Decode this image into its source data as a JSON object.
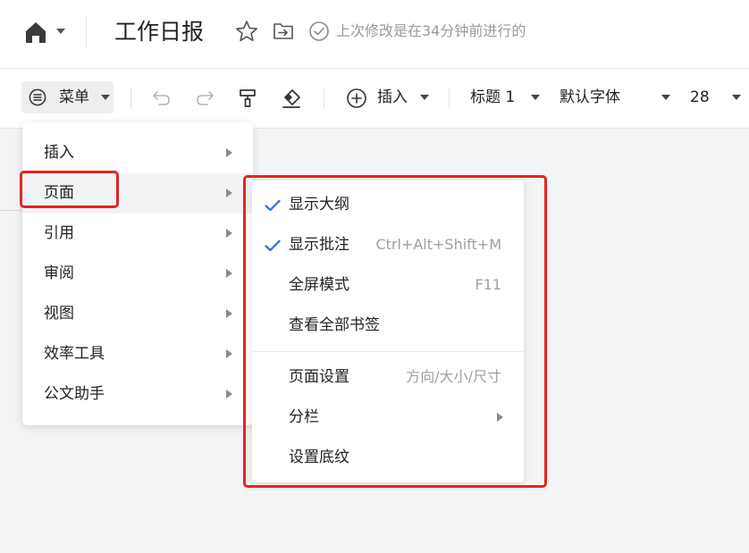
{
  "header": {
    "doc_title": "工作日报",
    "last_modified": "上次修改是在34分钟前进行的"
  },
  "toolbar": {
    "menu_label": "菜单",
    "insert_label": "插入",
    "heading_style": "标题 1",
    "font_family": "默认字体",
    "font_size": "28"
  },
  "menu": {
    "items": [
      {
        "label": "插入"
      },
      {
        "label": "页面"
      },
      {
        "label": "引用"
      },
      {
        "label": "审阅"
      },
      {
        "label": "视图"
      },
      {
        "label": "效率工具"
      },
      {
        "label": "公文助手"
      }
    ],
    "active_item": "页面"
  },
  "submenu": {
    "items": [
      {
        "label": "显示大纲",
        "checked": true
      },
      {
        "label": "显示批注",
        "checked": true,
        "hint": "Ctrl+Alt+Shift+M"
      },
      {
        "label": "全屏模式",
        "hint": "F11"
      },
      {
        "label": "查看全部书签"
      },
      {
        "label": "页面设置",
        "hint": "方向/大小/尺寸"
      },
      {
        "label": "分栏",
        "has_submenu": true
      },
      {
        "label": "设置底纹"
      }
    ]
  },
  "colors": {
    "highlight": "#e8231f",
    "check": "#2f6fe0",
    "menu_active_bg": "#f2f3f5"
  },
  "icons": [
    "home-icon",
    "star-icon",
    "move-to-folder-icon",
    "saved-check-icon",
    "menu-list-icon",
    "undo-icon",
    "redo-icon",
    "format-painter-icon",
    "eraser-icon",
    "plus-circle-icon",
    "chevron-right-icon",
    "checkmark-icon"
  ]
}
